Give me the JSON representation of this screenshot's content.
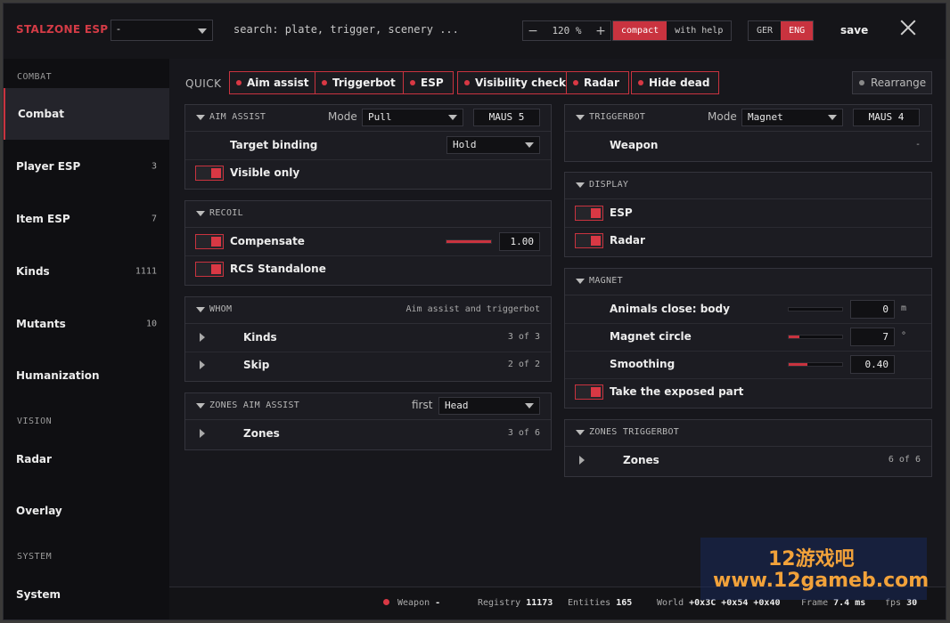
{
  "topbar": {
    "brand": "STALZONE ESP",
    "profile": "-",
    "search_placeholder": "search: plate, trigger, scenery ...",
    "zoom_value": "120 %",
    "zoom_minus": "−",
    "zoom_plus": "+",
    "modes": [
      "compact",
      "with help"
    ],
    "active_mode": "compact",
    "languages": [
      "GER",
      "ENG"
    ],
    "active_language": "ENG",
    "save": "save"
  },
  "sidebar": {
    "sections": [
      "COMBAT",
      "VISION",
      "SYSTEM"
    ],
    "items": [
      {
        "label": "Combat",
        "count": ""
      },
      {
        "label": "Player ESP",
        "count": "3"
      },
      {
        "label": "Item ESP",
        "count": "7"
      },
      {
        "label": "Kinds",
        "count": "1111"
      },
      {
        "label": "Mutants",
        "count": "10"
      },
      {
        "label": "Humanization",
        "count": ""
      },
      {
        "label": "Radar",
        "count": ""
      },
      {
        "label": "Overlay",
        "count": ""
      },
      {
        "label": "System",
        "count": ""
      }
    ]
  },
  "quick": {
    "label": "QUICK",
    "chips": [
      "Aim assist",
      "Triggerbot",
      "ESP",
      "Visibility check",
      "Radar",
      "Hide dead"
    ],
    "rearrange": "Rearrange"
  },
  "aim_assist": {
    "title": "AIM ASSIST",
    "mode_label": "Mode",
    "mode": "Pull",
    "key": "MAUS 5",
    "target_binding_label": "Target binding",
    "target_binding": "Hold",
    "visible_only": "Visible only"
  },
  "recoil": {
    "title": "RECOIL",
    "compensate": "Compensate",
    "compensate_value": "1.00",
    "compensate_fraction": 1.0,
    "rcs_standalone": "RCS Standalone"
  },
  "whom": {
    "title": "WHOM",
    "subtitle": "Aim assist and triggerbot",
    "rows": [
      {
        "label": "Kinds",
        "value": "3 of 3"
      },
      {
        "label": "Skip",
        "value": "2 of 2"
      }
    ]
  },
  "zones_aim": {
    "title": "ZONES AIM ASSIST",
    "first_label": "first",
    "first_value": "Head",
    "row_label": "Zones",
    "row_value": "3 of 6"
  },
  "triggerbot": {
    "title": "TRIGGERBOT",
    "mode_label": "Mode",
    "mode": "Magnet",
    "key": "MAUS 4",
    "weapon_label": "Weapon",
    "weapon_value": "-"
  },
  "display": {
    "title": "DISPLAY",
    "items": [
      "ESP",
      "Radar"
    ]
  },
  "magnet": {
    "title": "MAGNET",
    "rows": [
      {
        "label": "Animals close: body",
        "value": "0",
        "unit": "m",
        "fraction": 0.0
      },
      {
        "label": "Magnet circle",
        "value": "7",
        "unit": "°",
        "fraction": 0.2
      },
      {
        "label": "Smoothing",
        "value": "0.40",
        "unit": "",
        "fraction": 0.35
      }
    ],
    "exposed": "Take the exposed part"
  },
  "zones_trigger": {
    "title": "ZONES TRIGGERBOT",
    "row_label": "Zones",
    "row_value": "6 of 6"
  },
  "statusbar": {
    "weapon_label": "Weapon",
    "weapon_value": "-",
    "registry_label": "Registry",
    "registry_value": "11173",
    "entities_label": "Entities",
    "entities_value": "165",
    "world_label": "World",
    "world_value": "+0x3C +0x54 +0x40",
    "frame_label": "Frame",
    "frame_value": "7.4 ms",
    "fps_label": "fps",
    "fps_value": "30"
  },
  "watermark": {
    "line1": "12游戏吧",
    "line2": "www.12gameb.com"
  },
  "colors": {
    "accent": "#c9333f",
    "panel": "#1c1c22",
    "sidebar": "#0f0f12"
  }
}
